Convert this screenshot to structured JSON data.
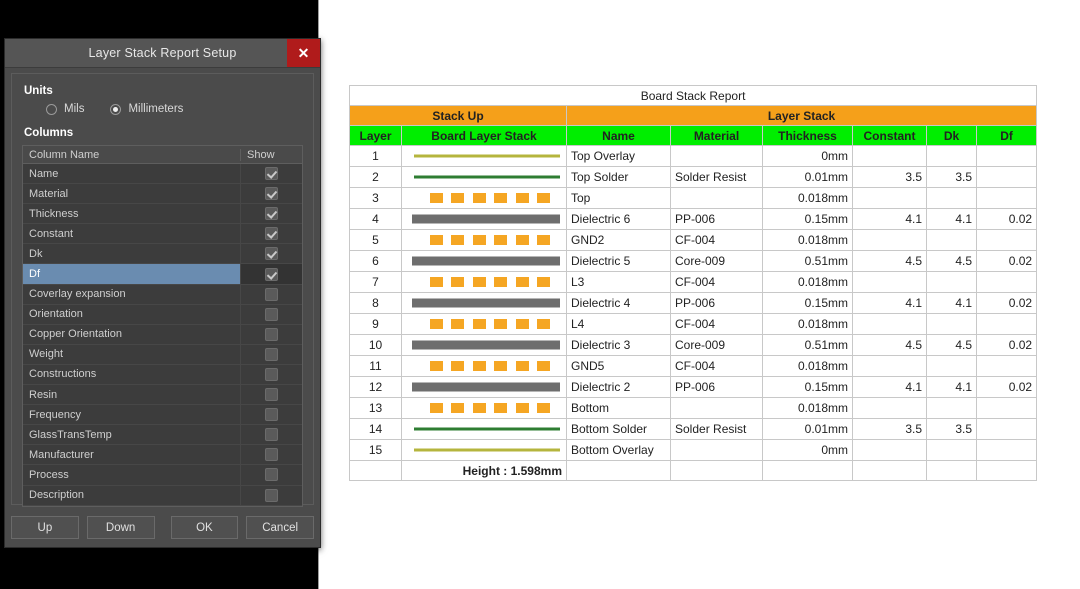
{
  "dialog": {
    "title": "Layer Stack Report Setup",
    "close_label": "✕",
    "units_label": "Units",
    "units_options": [
      {
        "label": "Mils",
        "selected": false
      },
      {
        "label": "Millimeters",
        "selected": true
      }
    ],
    "columns_label": "Columns",
    "list_headers": {
      "name": "Column Name",
      "show": "Show"
    },
    "columns": [
      {
        "name": "Name",
        "show": true,
        "selected": false
      },
      {
        "name": "Material",
        "show": true,
        "selected": false
      },
      {
        "name": "Thickness",
        "show": true,
        "selected": false
      },
      {
        "name": "Constant",
        "show": true,
        "selected": false
      },
      {
        "name": "Dk",
        "show": true,
        "selected": false
      },
      {
        "name": "Df",
        "show": true,
        "selected": true
      },
      {
        "name": "Coverlay expansion",
        "show": false,
        "selected": false
      },
      {
        "name": "Orientation",
        "show": false,
        "selected": false
      },
      {
        "name": "Copper Orientation",
        "show": false,
        "selected": false
      },
      {
        "name": "Weight",
        "show": false,
        "selected": false
      },
      {
        "name": "Constructions",
        "show": false,
        "selected": false
      },
      {
        "name": "Resin",
        "show": false,
        "selected": false
      },
      {
        "name": "Frequency",
        "show": false,
        "selected": false
      },
      {
        "name": "GlassTransTemp",
        "show": false,
        "selected": false
      },
      {
        "name": "Manufacturer",
        "show": false,
        "selected": false
      },
      {
        "name": "Process",
        "show": false,
        "selected": false
      },
      {
        "name": "Description",
        "show": false,
        "selected": false
      }
    ],
    "buttons": {
      "up": "Up",
      "down": "Down",
      "ok": "OK",
      "cancel": "Cancel"
    },
    "colors": {
      "titlebar": "#555555",
      "close": "#b01b1b",
      "selection": "#6a8cb0",
      "body": "#4b4b4b"
    }
  },
  "report": {
    "title": "Board Stack Report",
    "bands": [
      {
        "label": "Stack Up",
        "span": 2
      },
      {
        "label": "Layer Stack",
        "span": 6
      }
    ],
    "column_headers": [
      "Layer",
      "Board Layer Stack",
      "Name",
      "Material",
      "Thickness",
      "Constant",
      "Dk",
      "Df"
    ],
    "colors": {
      "band": "#F5A01A",
      "header": "#00EE00",
      "overlay_line": "#b5b53d",
      "solder_line": "#2e7d32",
      "copper": "#F5A623",
      "dielectric": "#6e6e6e"
    },
    "rows": [
      {
        "layer": "1",
        "gfx": "overlay",
        "name": "Top Overlay",
        "material": "",
        "thickness": "0mm",
        "constant": "",
        "dk": "",
        "df": ""
      },
      {
        "layer": "2",
        "gfx": "solder",
        "name": "Top Solder",
        "material": "Solder Resist",
        "thickness": "0.01mm",
        "constant": "3.5",
        "dk": "3.5",
        "df": ""
      },
      {
        "layer": "3",
        "gfx": "copper",
        "name": "Top",
        "material": "",
        "thickness": "0.018mm",
        "constant": "",
        "dk": "",
        "df": ""
      },
      {
        "layer": "4",
        "gfx": "dielectric",
        "name": "Dielectric 6",
        "material": "PP-006",
        "thickness": "0.15mm",
        "constant": "4.1",
        "dk": "4.1",
        "df": "0.02"
      },
      {
        "layer": "5",
        "gfx": "copper",
        "name": "GND2",
        "material": "CF-004",
        "thickness": "0.018mm",
        "constant": "",
        "dk": "",
        "df": ""
      },
      {
        "layer": "6",
        "gfx": "dielectric",
        "name": "Dielectric 5",
        "material": "Core-009",
        "thickness": "0.51mm",
        "constant": "4.5",
        "dk": "4.5",
        "df": "0.02"
      },
      {
        "layer": "7",
        "gfx": "copper",
        "name": "L3",
        "material": "CF-004",
        "thickness": "0.018mm",
        "constant": "",
        "dk": "",
        "df": ""
      },
      {
        "layer": "8",
        "gfx": "dielectric",
        "name": "Dielectric 4",
        "material": "PP-006",
        "thickness": "0.15mm",
        "constant": "4.1",
        "dk": "4.1",
        "df": "0.02"
      },
      {
        "layer": "9",
        "gfx": "copper",
        "name": "L4",
        "material": "CF-004",
        "thickness": "0.018mm",
        "constant": "",
        "dk": "",
        "df": ""
      },
      {
        "layer": "10",
        "gfx": "dielectric",
        "name": "Dielectric 3",
        "material": "Core-009",
        "thickness": "0.51mm",
        "constant": "4.5",
        "dk": "4.5",
        "df": "0.02"
      },
      {
        "layer": "11",
        "gfx": "copper",
        "name": "GND5",
        "material": "CF-004",
        "thickness": "0.018mm",
        "constant": "",
        "dk": "",
        "df": ""
      },
      {
        "layer": "12",
        "gfx": "dielectric",
        "name": "Dielectric 2",
        "material": "PP-006",
        "thickness": "0.15mm",
        "constant": "4.1",
        "dk": "4.1",
        "df": "0.02"
      },
      {
        "layer": "13",
        "gfx": "copper",
        "name": "Bottom",
        "material": "",
        "thickness": "0.018mm",
        "constant": "",
        "dk": "",
        "df": ""
      },
      {
        "layer": "14",
        "gfx": "solder",
        "name": "Bottom Solder",
        "material": "Solder Resist",
        "thickness": "0.01mm",
        "constant": "3.5",
        "dk": "3.5",
        "df": ""
      },
      {
        "layer": "15",
        "gfx": "overlay",
        "name": "Bottom Overlay",
        "material": "",
        "thickness": "0mm",
        "constant": "",
        "dk": "",
        "df": ""
      }
    ],
    "footer": {
      "height_label": "Height : 1.598mm"
    }
  }
}
